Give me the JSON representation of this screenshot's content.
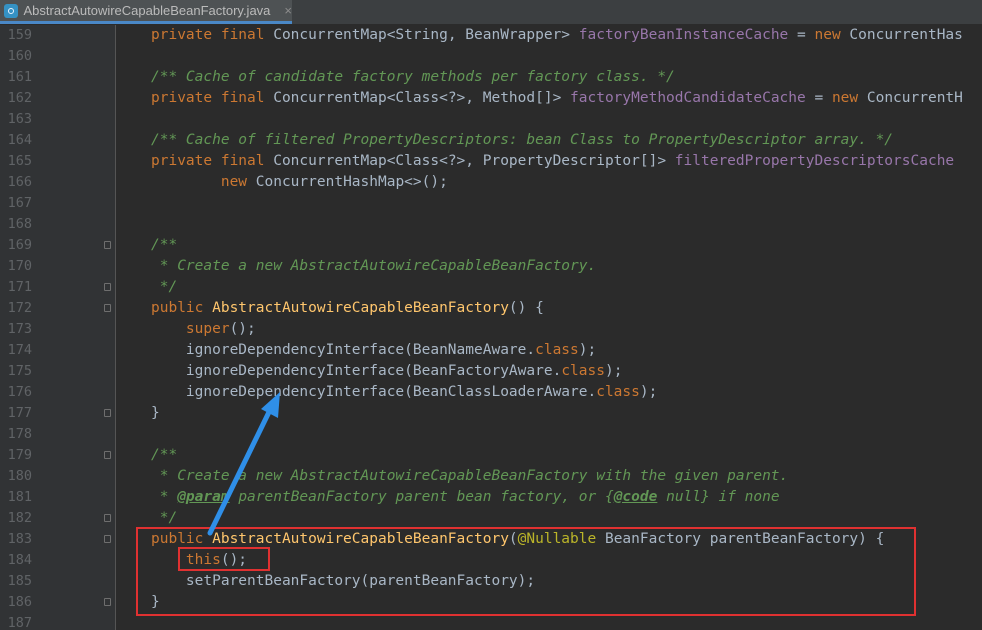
{
  "tab": {
    "title": "AbstractAutowireCapableBeanFactory.java",
    "close": "×"
  },
  "lines": [
    {
      "n": "159",
      "fold": false,
      "t": [
        [
          "kw",
          "private final "
        ],
        [
          "p",
          "ConcurrentMap<String, BeanWrapper> "
        ],
        [
          "field",
          "factoryBeanInstanceCache"
        ],
        [
          "p",
          " = "
        ],
        [
          "kw",
          "new "
        ],
        [
          "p",
          "ConcurrentHas"
        ]
      ]
    },
    {
      "n": "160",
      "fold": false,
      "t": []
    },
    {
      "n": "161",
      "fold": false,
      "t": [
        [
          "cm",
          "/** Cache of candidate factory methods per factory class. */"
        ]
      ]
    },
    {
      "n": "162",
      "fold": false,
      "t": [
        [
          "kw",
          "private final "
        ],
        [
          "p",
          "ConcurrentMap<Class<?>, Method[]> "
        ],
        [
          "field",
          "factoryMethodCandidateCache"
        ],
        [
          "p",
          " = "
        ],
        [
          "kw",
          "new "
        ],
        [
          "p",
          "ConcurrentH"
        ]
      ]
    },
    {
      "n": "163",
      "fold": false,
      "t": []
    },
    {
      "n": "164",
      "fold": false,
      "t": [
        [
          "cm",
          "/** Cache of filtered PropertyDescriptors: bean Class to PropertyDescriptor array. */"
        ]
      ]
    },
    {
      "n": "165",
      "fold": false,
      "t": [
        [
          "kw",
          "private final "
        ],
        [
          "p",
          "ConcurrentMap<Class<?>, PropertyDescriptor[]> "
        ],
        [
          "field",
          "filteredPropertyDescriptorsCache"
        ]
      ]
    },
    {
      "n": "166",
      "fold": false,
      "t": [
        [
          "p",
          "        "
        ],
        [
          "kw",
          "new "
        ],
        [
          "p",
          "ConcurrentHashMap<>();"
        ]
      ]
    },
    {
      "n": "167",
      "fold": false,
      "t": []
    },
    {
      "n": "168",
      "fold": false,
      "t": []
    },
    {
      "n": "169",
      "fold": true,
      "t": [
        [
          "cm",
          "/**"
        ]
      ]
    },
    {
      "n": "170",
      "fold": false,
      "t": [
        [
          "cm",
          " * Create a new AbstractAutowireCapableBeanFactory."
        ]
      ]
    },
    {
      "n": "171",
      "fold": true,
      "t": [
        [
          "cm",
          " */"
        ]
      ]
    },
    {
      "n": "172",
      "fold": true,
      "t": [
        [
          "kw",
          "public "
        ],
        [
          "fn",
          "AbstractAutowireCapableBeanFactory"
        ],
        [
          "p",
          "() {"
        ]
      ]
    },
    {
      "n": "173",
      "fold": false,
      "t": [
        [
          "p",
          "    "
        ],
        [
          "kw",
          "super"
        ],
        [
          "p",
          "();"
        ]
      ]
    },
    {
      "n": "174",
      "fold": false,
      "t": [
        [
          "p",
          "    ignoreDependencyInterface(BeanNameAware."
        ],
        [
          "kw",
          "class"
        ],
        [
          "p",
          ");"
        ]
      ]
    },
    {
      "n": "175",
      "fold": false,
      "t": [
        [
          "p",
          "    ignoreDependencyInterface(BeanFactoryAware."
        ],
        [
          "kw",
          "class"
        ],
        [
          "p",
          ");"
        ]
      ]
    },
    {
      "n": "176",
      "fold": false,
      "t": [
        [
          "p",
          "    ignoreDependencyInterface(BeanClassLoaderAware."
        ],
        [
          "kw",
          "class"
        ],
        [
          "p",
          ");"
        ]
      ]
    },
    {
      "n": "177",
      "fold": true,
      "t": [
        [
          "p",
          "}"
        ]
      ]
    },
    {
      "n": "178",
      "fold": false,
      "t": []
    },
    {
      "n": "179",
      "fold": true,
      "t": [
        [
          "cm",
          "/**"
        ]
      ]
    },
    {
      "n": "180",
      "fold": false,
      "t": [
        [
          "cm",
          " * Create a new AbstractAutowireCapableBeanFactory with the given parent."
        ]
      ]
    },
    {
      "n": "181",
      "fold": false,
      "t": [
        [
          "cm",
          " * "
        ],
        [
          "tag",
          "@param"
        ],
        [
          "cm",
          " parentBeanFactory parent bean factory, or {"
        ],
        [
          "tag",
          "@code"
        ],
        [
          "cm",
          " null} if none"
        ]
      ]
    },
    {
      "n": "182",
      "fold": true,
      "t": [
        [
          "cm",
          " */"
        ]
      ]
    },
    {
      "n": "183",
      "fold": true,
      "t": [
        [
          "kw",
          "public "
        ],
        [
          "fn",
          "AbstractAutowireCapableBeanFactory"
        ],
        [
          "p",
          "("
        ],
        [
          "ann",
          "@Nullable "
        ],
        [
          "p",
          "BeanFactory parentBeanFactory) {"
        ]
      ]
    },
    {
      "n": "184",
      "fold": false,
      "t": [
        [
          "p",
          "    "
        ],
        [
          "kw",
          "this"
        ],
        [
          "p",
          "();"
        ]
      ]
    },
    {
      "n": "185",
      "fold": false,
      "t": [
        [
          "p",
          "    setParentBeanFactory(parentBeanFactory);"
        ]
      ]
    },
    {
      "n": "186",
      "fold": true,
      "t": [
        [
          "p",
          "}"
        ]
      ]
    },
    {
      "n": "187",
      "fold": false,
      "t": []
    }
  ],
  "colors": {
    "highlight": "#e03131",
    "arrow": "#2f8fe8"
  }
}
